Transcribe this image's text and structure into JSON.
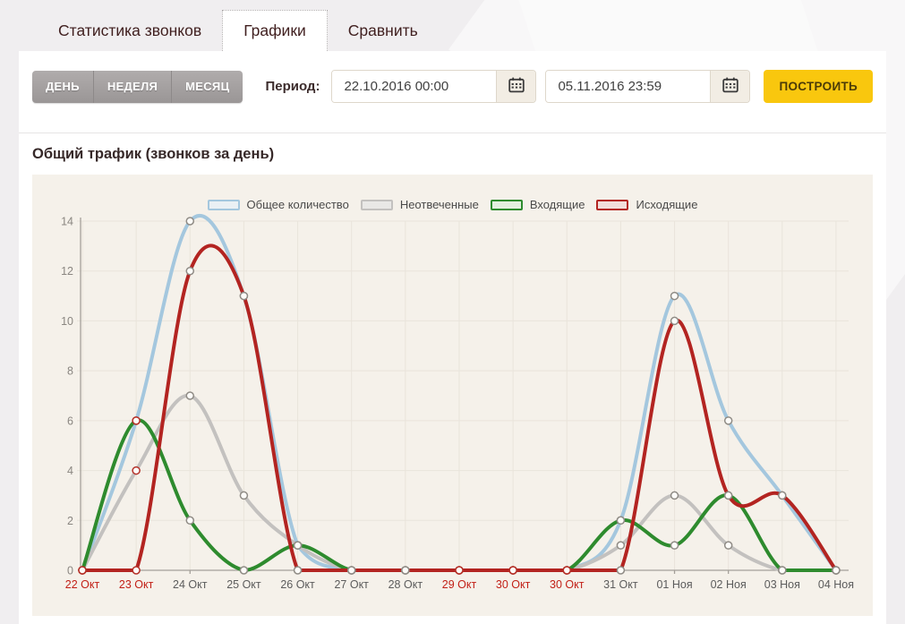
{
  "tabs": [
    {
      "label": "Статистика звонков"
    },
    {
      "label": "Графики"
    },
    {
      "label": "Сравнить"
    }
  ],
  "active_tab": "Графики",
  "filters": {
    "range_buttons": [
      "ДЕНЬ",
      "НЕДЕЛЯ",
      "МЕСЯЦ"
    ],
    "period_label": "Период:",
    "date_from": "22.10.2016 00:00",
    "date_to": "05.11.2016 23:59",
    "build_label": "ПОСТРОИТЬ"
  },
  "section_title": "Общий трафик (звонков за день)",
  "colors": {
    "accent_yellow": "#f9c70e",
    "tab_text": "#401f1f",
    "panel_bg": "#f5f1ea",
    "weekend_label": "#c22017"
  },
  "chart_data": {
    "type": "line",
    "title": "Общий трафик (звонков за день)",
    "categories": [
      "22 Окт",
      "23 Окт",
      "24 Окт",
      "25 Окт",
      "26 Окт",
      "27 Окт",
      "28 Окт",
      "29 Окт",
      "30 Окт",
      "30 Окт",
      "31 Окт",
      "01 Ноя",
      "02 Ноя",
      "03 Ноя",
      "04 Ноя"
    ],
    "weekend_indices": [
      0,
      1,
      7,
      8,
      9
    ],
    "ylim": [
      0,
      14
    ],
    "ytick_step": 2,
    "grid": true,
    "legend_position": "top",
    "smooth": true,
    "series": [
      {
        "name": "Общее количество",
        "line": "#a4c7de",
        "legend_fill": "#eaf0f4",
        "values": [
          0,
          6,
          14,
          11,
          1,
          0,
          0,
          0,
          0,
          0,
          2,
          11,
          6,
          3,
          0
        ]
      },
      {
        "name": "Неотвеченные",
        "line": "#c3c1bf",
        "legend_fill": "#e9e8e6",
        "values": [
          0,
          4,
          7,
          3,
          1,
          0,
          0,
          0,
          0,
          0,
          1,
          3,
          1,
          0,
          0
        ]
      },
      {
        "name": "Входящие",
        "line": "#2e8b2e",
        "legend_fill": "#e3efdf",
        "values": [
          0,
          6,
          2,
          0,
          1,
          0,
          0,
          0,
          0,
          0,
          2,
          1,
          3,
          0,
          0
        ]
      },
      {
        "name": "Исходящие",
        "line": "#b32421",
        "legend_fill": "#f2dddb",
        "values": [
          0,
          0,
          12,
          11,
          0,
          0,
          0,
          0,
          0,
          0,
          0,
          10,
          3,
          3,
          0
        ]
      }
    ],
    "marker_color": "#8f8b85",
    "weekend_marker_color": "#b43028",
    "grid_color": "#e9e4db",
    "axis_color": "#a5a09a"
  }
}
